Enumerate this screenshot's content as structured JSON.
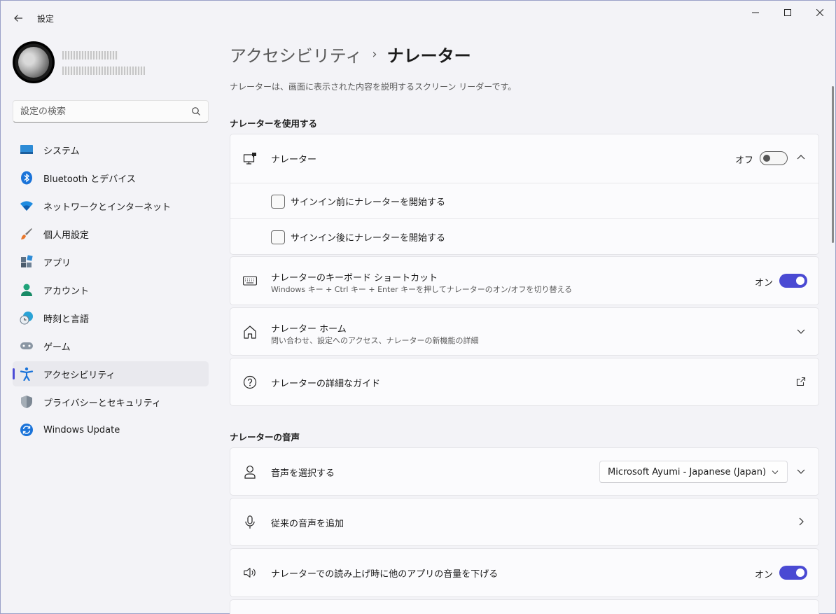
{
  "window": {
    "app_title": "設定",
    "controls": {
      "minimize": "—",
      "maximize": "☐",
      "close": "✕"
    }
  },
  "search": {
    "placeholder": "設定の検索"
  },
  "sidebar": {
    "items": [
      {
        "label": "システム",
        "icon": "system-icon"
      },
      {
        "label": "Bluetooth とデバイス",
        "icon": "bluetooth-icon"
      },
      {
        "label": "ネットワークとインターネット",
        "icon": "wifi-icon"
      },
      {
        "label": "個人用設定",
        "icon": "brush-icon"
      },
      {
        "label": "アプリ",
        "icon": "apps-icon"
      },
      {
        "label": "アカウント",
        "icon": "account-icon"
      },
      {
        "label": "時刻と言語",
        "icon": "time-language-icon"
      },
      {
        "label": "ゲーム",
        "icon": "gamepad-icon"
      },
      {
        "label": "アクセシビリティ",
        "icon": "accessibility-icon",
        "active": true
      },
      {
        "label": "プライバシーとセキュリティ",
        "icon": "shield-icon"
      },
      {
        "label": "Windows Update",
        "icon": "update-icon"
      }
    ]
  },
  "breadcrumb": {
    "parent": "アクセシビリティ",
    "separator": "›",
    "current": "ナレーター"
  },
  "page_description": "ナレーターは、画面に表示された内容を説明するスクリーン リーダーです。",
  "sections": {
    "use": {
      "title": "ナレーターを使用する",
      "narrator": {
        "title": "ナレーター",
        "state": "オフ",
        "enabled": false
      },
      "sign_in_before": {
        "label": "サインイン前にナレーターを開始する",
        "checked": false
      },
      "sign_in_after": {
        "label": "サインイン後にナレーターを開始する",
        "checked": false
      },
      "shortcut": {
        "title": "ナレーターのキーボード ショートカット",
        "subtitle": "Windows キー + Ctrl キー + Enter キーを押してナレーターのオン/オフを切り替える",
        "state": "オン",
        "enabled": true
      },
      "home": {
        "title": "ナレーター ホーム",
        "subtitle": "問い合わせ、設定へのアクセス、ナレーターの新機能の詳細"
      },
      "guide": {
        "title": "ナレーターの詳細なガイド"
      }
    },
    "voice": {
      "title": "ナレーターの音声",
      "select_voice": {
        "title": "音声を選択する",
        "value": "Microsoft Ayumi - Japanese (Japan)"
      },
      "legacy_voice": {
        "title": "従来の音声を追加"
      },
      "lower_volume": {
        "title": "ナレーターでの読み上げ時に他のアプリの音量を下げる",
        "state": "オン",
        "enabled": true
      }
    }
  },
  "colors": {
    "accent": "#4a4ad3",
    "window_bg": "#f3f3f7",
    "card_bg": "#fbfbfd"
  }
}
